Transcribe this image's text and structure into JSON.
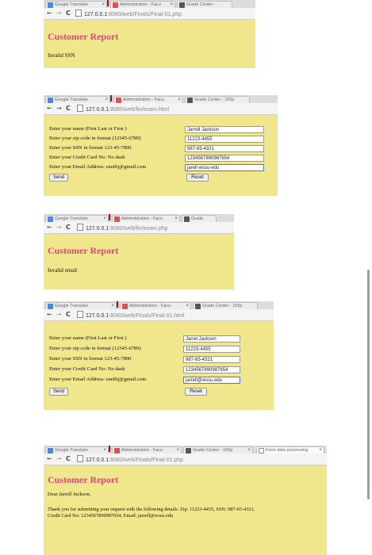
{
  "tabs": {
    "google_translate": "Google Translate",
    "administration": "Administration - Facu",
    "grade_center": "Grade Center -",
    "grade_center_long": "Grade Center - 165p",
    "grade_center_short": "Grade",
    "form_data": "Form data processing"
  },
  "shots": [
    {
      "url_host": "127.0.0.1",
      "url_path": ":8080/web/Finals/Final-01.php",
      "title": "Customer Report",
      "message": "Invalid SSN"
    },
    {
      "url_host": "127.0.0.1",
      "url_path": ":8080/web/fin/exam.html",
      "form": {
        "labels": [
          "Enter your name (First Last or First )",
          "Enter your zip code in format (12345-6789)",
          "Enter your SSN in format 123-45-7890",
          "Enter your Credit Card No: No dash",
          "Enter your Email Address: smithj@gmail.com"
        ],
        "values": [
          "Jarrell Jackson",
          "11223-4455",
          "987-65-4321",
          "1234567890987654",
          "jarell-wssu-edu"
        ],
        "send": "Send",
        "reset": "Reset"
      }
    },
    {
      "url_host": "127.0.0.1",
      "url_path": ":8080/web/fin/exam.php",
      "title": "Customer Report",
      "message": "Invalid email"
    },
    {
      "url_host": "127.0.0.1",
      "url_path": ":8080/web/Finals/Final-01.html",
      "form": {
        "labels": [
          "Enter your name (First Last or First )",
          "Enter your zip code in format (12345-6789)",
          "Enter your SSN in format 123-45-7890",
          "Enter your Credit Card No: No dash",
          "Enter your Email Address: smithj@gmail.com"
        ],
        "values": [
          "Jarrel Jackson",
          "11223-4455",
          "987-65-4321",
          "1234567890987654",
          "jarrell@wssu.edu"
        ],
        "send": "Send",
        "reset": "Reset"
      }
    },
    {
      "url_host": "127.0.0.1",
      "url_path": ":8080/web/Finals/Final-01.php",
      "title": "Customer Report",
      "greeting": "Dear Jarrell Jackson,",
      "body_line1": "Thank you for submitting your request with the following details: Zip: 11223-4455, SSN: 987-65-4321,",
      "body_line2": "Credit Card No: 1234567890987654, Email: jarrell@wssu.edu"
    }
  ]
}
